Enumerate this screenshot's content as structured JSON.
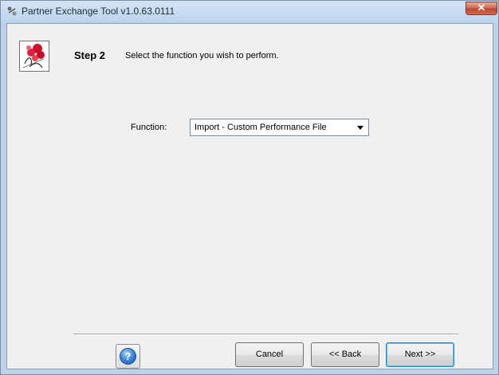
{
  "window": {
    "title": "Partner Exchange Tool v1.0.63.0111",
    "close_glyph": "✕"
  },
  "header": {
    "step_title": "Step 2",
    "step_description": "Select the function you wish to perform."
  },
  "form": {
    "function_label": "Function:",
    "function_value": "Import - Custom Performance File"
  },
  "footer": {
    "help_glyph": "?",
    "cancel_label": "Cancel",
    "back_label": "<< Back",
    "next_label": "Next >>"
  },
  "colors": {
    "window_frame": "#bcd2ea",
    "client_bg": "#f0f0f0",
    "close_button": "#c2452c",
    "help_blue": "#3a86d8",
    "default_button_border": "#3c7fb1"
  },
  "icons": {
    "app": "app-icon",
    "logo": "company-logo",
    "close": "close-icon",
    "help": "help-icon",
    "dropdown": "chevron-down-icon"
  }
}
